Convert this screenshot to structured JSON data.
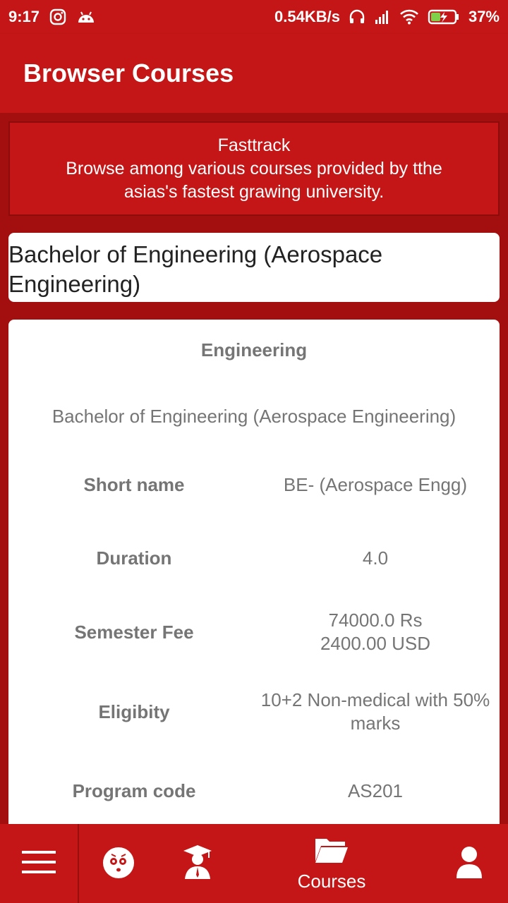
{
  "status_bar": {
    "time": "9:17",
    "network_speed": "0.54KB/s",
    "battery": "37%"
  },
  "app_bar": {
    "title": "Browser Courses"
  },
  "banner": {
    "title": "Fasttrack",
    "description": "Browse among various courses provided by tthe asias's fastest grawing university."
  },
  "course": {
    "title": "Bachelor of Engineering (Aerospace Engineering)",
    "category": "Engineering",
    "full_name": "Bachelor of Engineering (Aerospace Engineering)",
    "details": [
      {
        "label": "Short name",
        "value": "BE- (Aerospace Engg)"
      },
      {
        "label": "Duration",
        "value": "4.0"
      },
      {
        "label": "Semester Fee",
        "value_line1": "74000.0 Rs",
        "value_line2": "2400.00 USD"
      },
      {
        "label": "Eligibity",
        "value": "10+2 Non-medical with 50% marks"
      },
      {
        "label": "Program code",
        "value": "AS201"
      }
    ]
  },
  "bottom_nav": {
    "items": [
      {
        "icon": "menu-icon"
      },
      {
        "icon": "mascot-face-icon"
      },
      {
        "icon": "graduate-icon"
      },
      {
        "icon": "folder-icon",
        "label": "Courses"
      },
      {
        "icon": "profile-icon"
      }
    ]
  },
  "colors": {
    "primary": "#c41616",
    "background": "#a30e0e",
    "card": "#ffffff",
    "muted_text": "#757575"
  }
}
